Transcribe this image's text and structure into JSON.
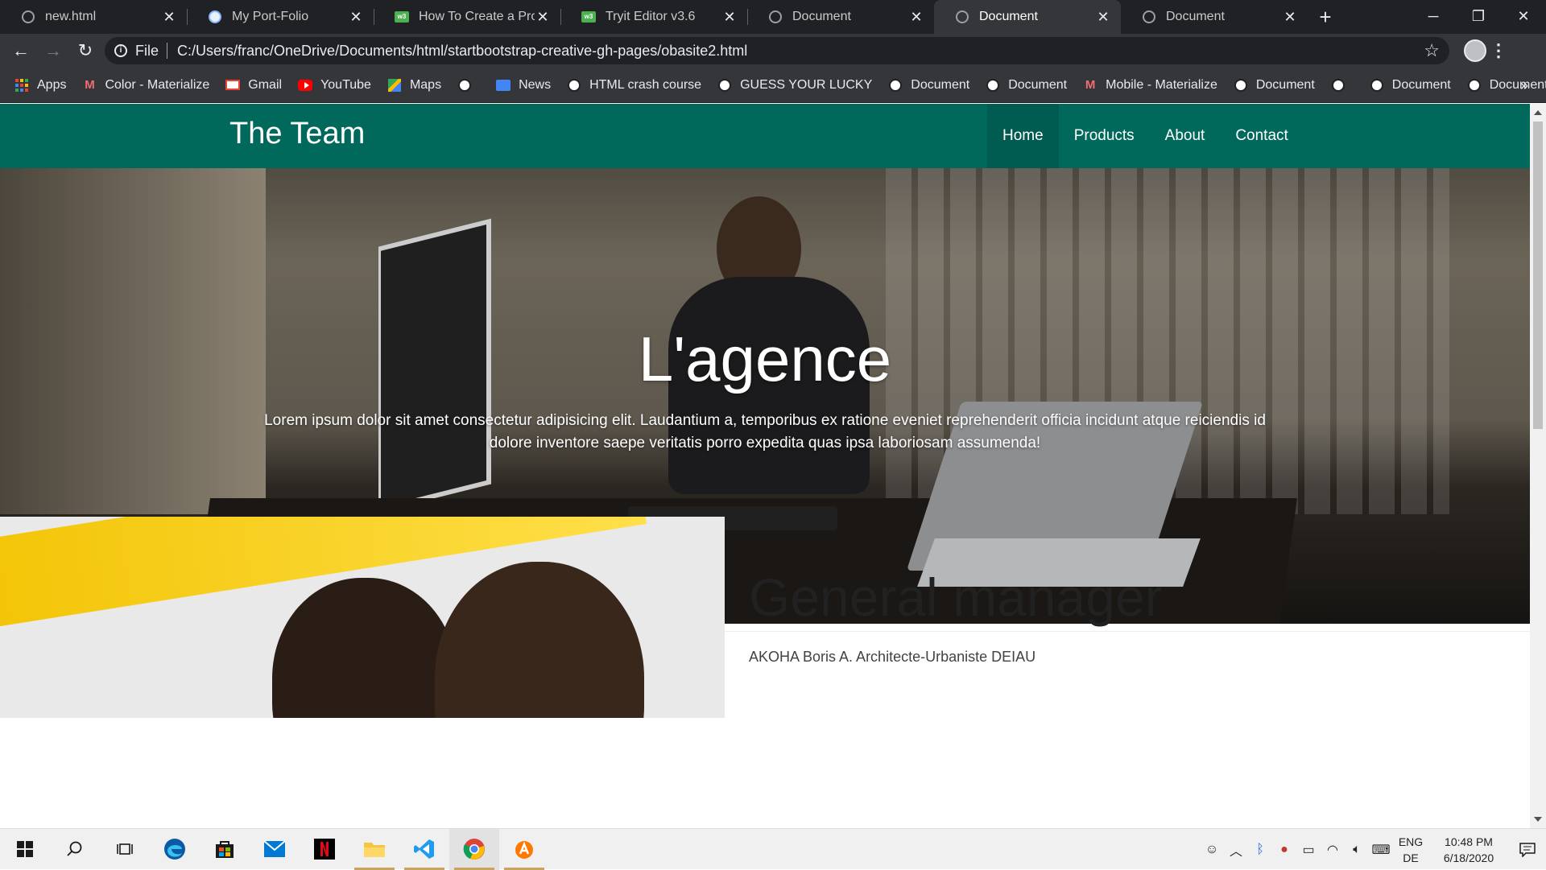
{
  "browser": {
    "tabs": [
      {
        "title": "new.html",
        "icon": "globe-icon",
        "active": false
      },
      {
        "title": "My Port-Folio",
        "icon": "portfolio-icon",
        "active": false
      },
      {
        "title": "How To Create a Profile",
        "icon": "w3schools-icon",
        "active": false
      },
      {
        "title": "Tryit Editor v3.6",
        "icon": "w3schools-icon",
        "active": false
      },
      {
        "title": "Document",
        "icon": "globe-icon",
        "active": false
      },
      {
        "title": "Document",
        "icon": "globe-icon",
        "active": true
      },
      {
        "title": "Document",
        "icon": "globe-icon",
        "active": false
      }
    ],
    "address": {
      "scheme_label": "File",
      "url": "C:/Users/franc/OneDrive/Documents/html/startbootstrap-creative-gh-pages/obasite2.html"
    },
    "bookmarks": [
      {
        "label": "Apps",
        "icon": "apps-grid-icon"
      },
      {
        "label": "Color - Materialize",
        "icon": "materialize-icon"
      },
      {
        "label": "Gmail",
        "icon": "gmail-icon"
      },
      {
        "label": "YouTube",
        "icon": "youtube-icon"
      },
      {
        "label": "Maps",
        "icon": "maps-icon"
      },
      {
        "label": "",
        "icon": "globe-icon"
      },
      {
        "label": "News",
        "icon": "news-icon"
      },
      {
        "label": "HTML crash course",
        "icon": "globe-icon"
      },
      {
        "label": "GUESS YOUR LUCKY",
        "icon": "globe-icon"
      },
      {
        "label": "Document",
        "icon": "globe-icon"
      },
      {
        "label": "Document",
        "icon": "globe-icon"
      },
      {
        "label": "Mobile - Materialize",
        "icon": "materialize-icon"
      },
      {
        "label": "Document",
        "icon": "globe-icon"
      },
      {
        "label": "",
        "icon": "globe-icon"
      },
      {
        "label": "Document",
        "icon": "globe-icon"
      },
      {
        "label": "Document",
        "icon": "globe-icon"
      }
    ],
    "more_bookmarks": "»"
  },
  "site": {
    "brand": "The Team",
    "nav": [
      {
        "label": "Home",
        "active": true
      },
      {
        "label": "Products",
        "active": false
      },
      {
        "label": "About",
        "active": false
      },
      {
        "label": "Contact",
        "active": false
      }
    ],
    "hero": {
      "title": "L'agence",
      "text": "Lorem ipsum dolor sit amet consectetur adipisicing elit. Laudantium a, temporibus ex ratione eveniet reprehenderit officia incidunt atque reiciendis id dolore inventore saepe veritatis porro expedita quas ipsa laboriosam assumenda!"
    },
    "manager": {
      "title": "General manager",
      "subtitle": "AKOHA Boris A. Architecte-Urbaniste DEIAU"
    }
  },
  "taskbar": {
    "apps": [
      "windows-start-icon",
      "search-icon",
      "task-view-icon",
      "edge-icon",
      "store-icon",
      "mail-icon",
      "netflix-icon",
      "file-explorer-icon",
      "vscode-icon",
      "chrome-icon",
      "avast-icon"
    ],
    "lang_top": "ENG",
    "lang_bottom": "DE",
    "time": "10:48 PM",
    "date": "6/18/2020"
  },
  "colors": {
    "navbar": "#00695c",
    "tab_strip": "#202124",
    "toolbar": "#35363a"
  }
}
